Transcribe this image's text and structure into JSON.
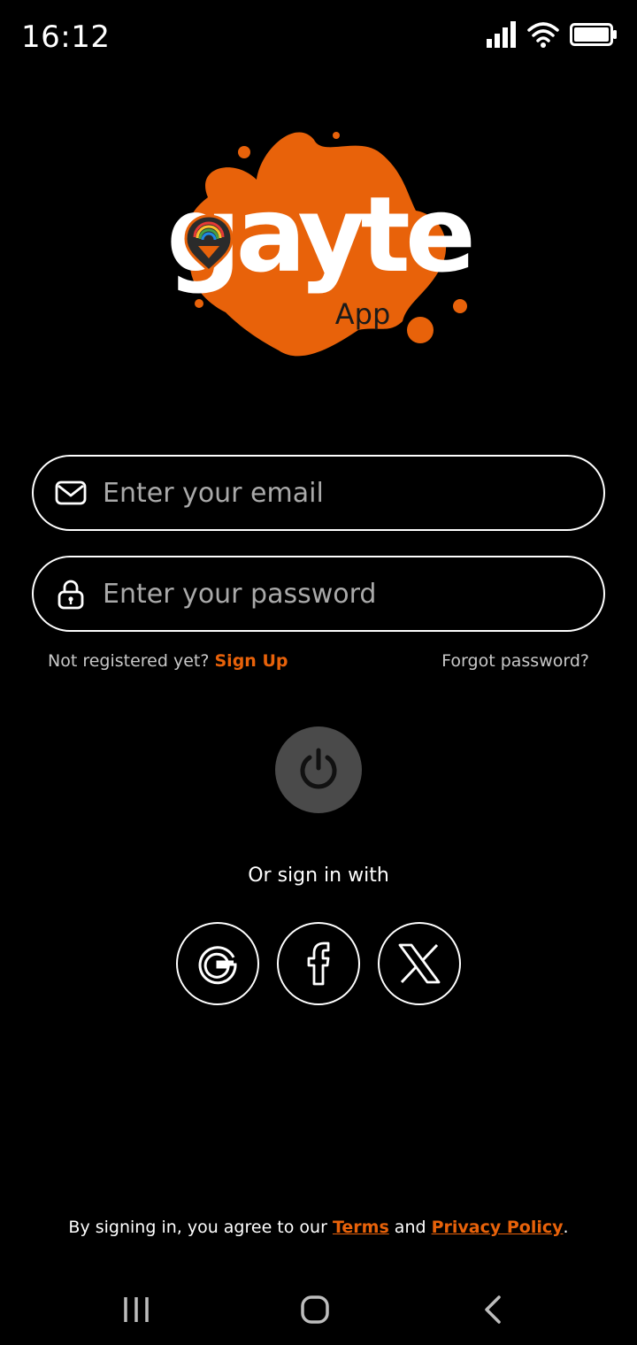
{
  "status_bar": {
    "time": "16:12",
    "icons": [
      "signal-icon",
      "wifi-icon",
      "battery-icon"
    ]
  },
  "logo": {
    "wordmark": "gayte",
    "subtitle": "App",
    "accent_color": "#E8620A"
  },
  "login_form": {
    "email": {
      "placeholder": "Enter your email",
      "value": "",
      "icon": "mail-icon"
    },
    "password": {
      "placeholder": "Enter your password",
      "value": "",
      "icon": "lock-icon"
    },
    "not_registered_text": "Not registered yet?",
    "signup_label": "Sign Up",
    "forgot_label": "Forgot password?",
    "submit_icon": "power-icon"
  },
  "social": {
    "title": "Or sign in with",
    "providers": [
      {
        "name": "Google",
        "icon": "google-icon"
      },
      {
        "name": "Facebook",
        "icon": "facebook-icon"
      },
      {
        "name": "X",
        "icon": "x-icon"
      }
    ]
  },
  "terms": {
    "prefix": "By signing in, you agree to our ",
    "terms_label": "Terms",
    "and_text": " and ",
    "privacy_label": "Privacy Policy",
    "suffix": "."
  },
  "colors": {
    "background": "#000000",
    "accent": "#E8620A",
    "button_bg": "#4a4a4a",
    "muted_text": "#c8c8c8"
  }
}
